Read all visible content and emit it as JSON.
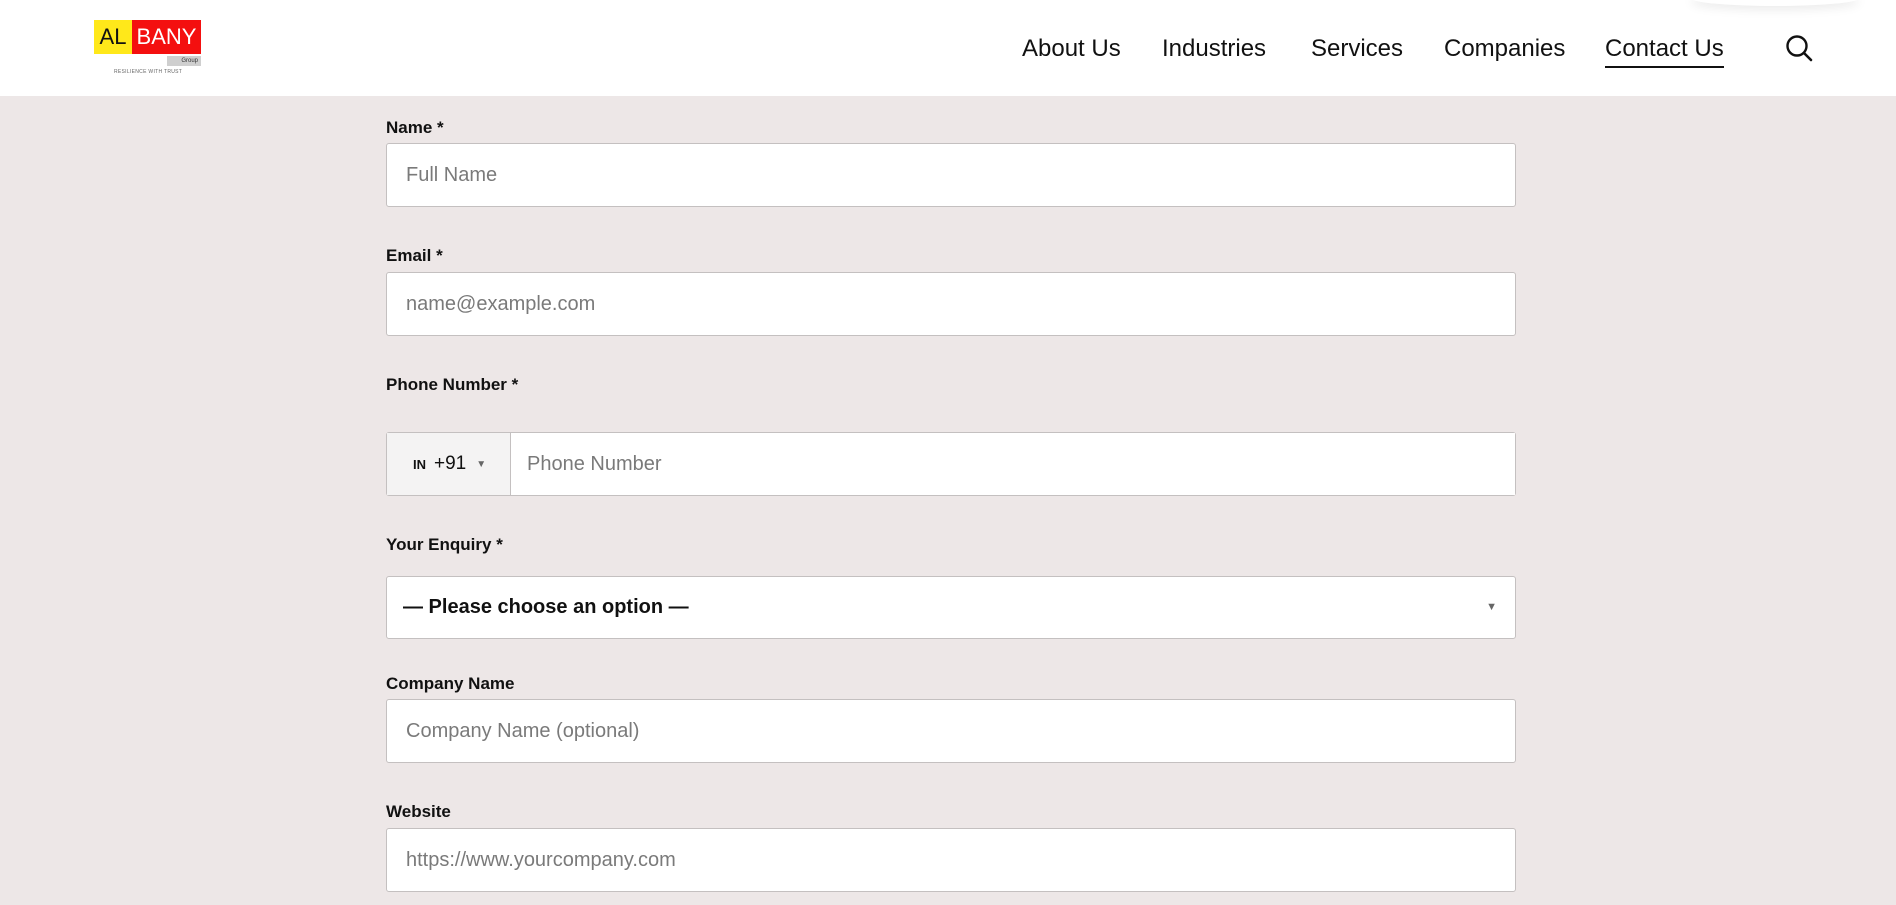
{
  "brand": {
    "logo_left": "AL",
    "logo_right": "BANY",
    "logo_sub": "Group",
    "logo_tagline": "RESILIENCE WITH TRUST",
    "colors": {
      "yellow": "#ffe81a",
      "red": "#f40f0f"
    }
  },
  "nav": {
    "items": [
      {
        "label": "About Us"
      },
      {
        "label": "Industries"
      },
      {
        "label": "Services"
      },
      {
        "label": "Companies"
      },
      {
        "label": "Contact Us",
        "active": true
      }
    ],
    "search_icon": "search-icon"
  },
  "form": {
    "name": {
      "label": "Name *",
      "placeholder": "Full Name"
    },
    "email": {
      "label": "Email *",
      "placeholder": "name@example.com"
    },
    "phone": {
      "label": "Phone Number *",
      "country_flag": "IN",
      "country_code": "+91",
      "placeholder": "Phone Number"
    },
    "enquiry": {
      "label": "Your Enquiry *",
      "selected": "— Please choose an option —"
    },
    "company": {
      "label": "Company Name",
      "placeholder": "Company Name (optional)"
    },
    "website": {
      "label": "Website",
      "placeholder": "https://www.yourcompany.com"
    }
  },
  "colors": {
    "page_bg": "#ede7e7",
    "header_bg": "#ffffff",
    "border": "#c4c0c0"
  }
}
